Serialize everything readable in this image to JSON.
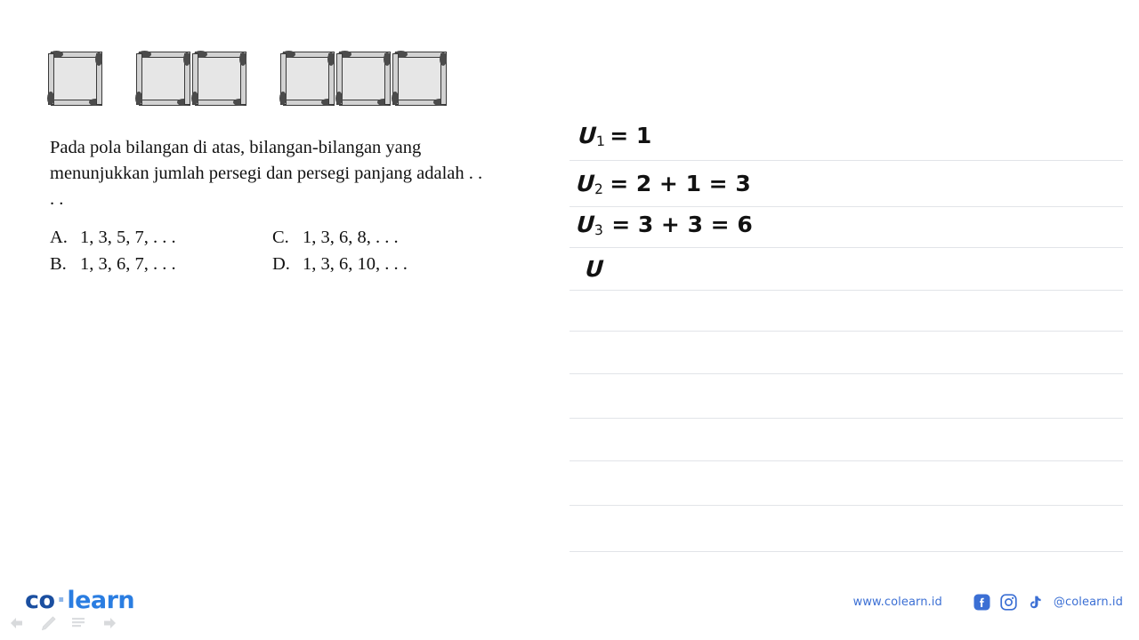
{
  "question": {
    "figure": {
      "name": "matchstick-square-pattern",
      "groups": [
        1,
        2,
        3
      ],
      "caption_alt": "Pola persegi dari batang korek api"
    },
    "text": "Pada pola bilangan di atas, bilangan-bilangan yang menunjukkan jumlah persegi dan persegi panjang adalah . . . .",
    "options": [
      {
        "letter": "A.",
        "value": "1, 3, 5, 7, . . ."
      },
      {
        "letter": "C.",
        "value": "1, 3, 6, 8, . . ."
      },
      {
        "letter": "B.",
        "value": "1, 3, 6, 7, . . ."
      },
      {
        "letter": "D.",
        "value": "1, 3, 6, 10, . . ."
      }
    ]
  },
  "worksheet": {
    "lines": [
      {
        "term": "U",
        "index": "1",
        "body": "=  1"
      },
      {
        "term": "U",
        "index": "2",
        "body": "=  2 + 1 = 3"
      },
      {
        "term": "U",
        "index": "3",
        "body": "=  3 + 3 = 6"
      },
      {
        "term": "U",
        "index": "",
        "body": ""
      }
    ]
  },
  "footer": {
    "logo": {
      "co": "co",
      "dot": "·",
      "learn": "learn"
    },
    "url": "www.colearn.id",
    "handle": "@colearn.id",
    "social": [
      "facebook-icon",
      "instagram-icon",
      "tiktok-icon"
    ],
    "tools": [
      "undo-arrow-icon",
      "pencil-icon",
      "lines-icon",
      "redo-arrow-icon"
    ],
    "accent": "#3b6fd4"
  }
}
